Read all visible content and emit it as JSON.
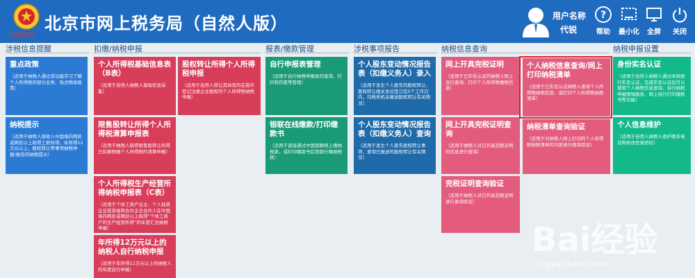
{
  "header": {
    "logo_text": "中国税务",
    "title": "北京市网上税务局（自然人版）",
    "user_label": "用户名称",
    "user_id": "代锐",
    "buttons": [
      {
        "label": "帮助",
        "icon": "help-icon"
      },
      {
        "label": "最小化",
        "icon": "minimize-icon"
      },
      {
        "label": "全屏",
        "icon": "fullscreen-icon"
      },
      {
        "label": "关闭",
        "icon": "power-icon"
      }
    ]
  },
  "sections": [
    "涉税信息提醒",
    "扣缴/纳税申报",
    "报表/缴款管理",
    "涉税事项报告",
    "纳税信息查询",
    "纳税申报设置"
  ],
  "tiles": {
    "t1": {
      "title": "重点政策",
      "desc": "（适用于纳税人通过该功能学习了解个人所得税的部分业务、热点税收政策）"
    },
    "t2": {
      "title": "纳税提示",
      "desc": "（适用于纳税人按收入中国境内两处或两处以上取得工薪所得、年所得12万元以上、股权转让等事项纳税申报/报告的纳税提示）"
    },
    "t3": {
      "title": "个人所得税基础信息表（B表）",
      "desc": "（适用于自然人纳税人基础信息采集）"
    },
    "t4": {
      "title": "股权转让所得个人所得税申报",
      "desc": "（适用于自然人转让其持有的在我市登记注册企业股权的个人所得税纳税申报）"
    },
    "t5": {
      "title": "限售股转让所得个人所得税清算申报表",
      "desc": "（适用于纳税人取得限售股转让所得已扣缴预缴个人所得税的清算申报）"
    },
    "t6": {
      "title": "个人所得税生产经营所得纳税申报表（C表）",
      "desc": "（适用于个体工商户业主、个人独资企业投资者和合伙企业合伙人在中国境内两处或两处以上取得“个体工商户的生产经营所得”的年度汇总纳税申报）"
    },
    "t7": {
      "title": "年所得12万元以上的纳税人自行纳税申报",
      "desc": "（适用于年所得12万元以上的纳税人的年度自行申报）"
    },
    "t8": {
      "title": "自行申报表管理",
      "desc": "（适用于自行纳税申报表的查询、打印和作废等管理）"
    },
    "t9": {
      "title": "银联在线缴款/打印缴款书",
      "desc": "（适用于直接通过中国银联网上缴纳税款，或打印缴款书后到银行缴纳税款）"
    },
    "t10": {
      "title": "个人股东变动情况报告表（扣缴义务人）录入",
      "desc": "（适用于发生个人股东的股权转让、股权转让相关协议签订后5个工作日内，向税务机关报送股权转让有关情况）"
    },
    "t11": {
      "title": "个人股东变动情况报告表（扣缴义务人）查询",
      "desc": "（适用于发生个人股东股权转让事项、查询已报送的股权转让有关情况）"
    },
    "t12": {
      "title": "网上开具完税证明",
      "desc": "（适用于已实名认证的纳税人网上自行查询、打印个人所得税缴税信息）"
    },
    "t13": {
      "title": "网上开具完税证明查询",
      "desc": "（适用于纳税人对已开具完税证明的信息进行查询）"
    },
    "t14": {
      "title": "完税证明查询验证",
      "desc": "（适用于纳税人对已开具完税证明进行查询验证）"
    },
    "t15": {
      "title": "个人纳税信息查询/网上打印纳税清单",
      "desc": "（适用于已实名认证纳税人查询个人所得税纳税信息、或打印个人所得税纳税清单）"
    },
    "t16": {
      "title": "纳税清单查询验证",
      "desc": "（适用于对纳税人网上打印的个人所得税纳税清单的内容进行查询验证）"
    },
    "t17": {
      "title": "身份实名认证",
      "desc": "（适用于自然人纳税人通过本网进行实名认证，完成实名认证后可以使用个人纳税信息查询、自行纳税申报预填报表、网上自行打印缴税书等功能）"
    },
    "t18": {
      "title": "个人信息维护",
      "desc": "（适用于自然人纳税人维护联系电话和修改登录密码）"
    }
  },
  "watermark": {
    "brand": "Bai经验",
    "url": "jingyan.baidu.com"
  }
}
